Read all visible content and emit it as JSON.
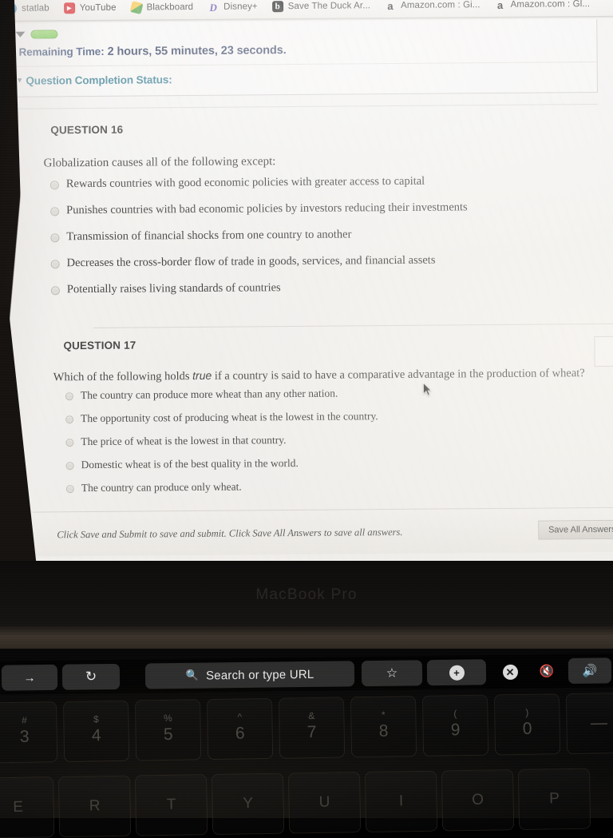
{
  "browser": {
    "bookmarks": [
      {
        "label": "statlab",
        "icon": "statlab-icon"
      },
      {
        "label": "YouTube",
        "icon": "youtube-icon"
      },
      {
        "label": "Blackboard",
        "icon": "blackboard-icon"
      },
      {
        "label": "Disney+",
        "icon": "disney-plus-icon"
      },
      {
        "label": "Save The Duck Ar...",
        "icon": "save-the-duck-icon"
      },
      {
        "label": "Amazon.com : Gi...",
        "icon": "amazon-icon"
      },
      {
        "label": "Amazon.com : Gl...",
        "icon": "amazon-icon"
      }
    ]
  },
  "exam": {
    "remaining_time_label": "Remaining Time:",
    "remaining_time_value": "2 hours, 55 minutes, 23 seconds.",
    "question_completion_status": "Question Completion Status:",
    "status_pill_color": "#76cc45",
    "questions": [
      {
        "heading": "QUESTION 16",
        "stem": "Globalization causes all of the following except:",
        "stem_italic_word": "",
        "options": [
          "Rewards countries with good economic policies with greater access to capital",
          "Punishes countries with bad economic policies by investors reducing their investments",
          "Transmission of financial shocks from one country to another",
          "Decreases the cross-border flow of trade in goods, services, and financial assets",
          "Potentially raises living standards of countries"
        ]
      },
      {
        "heading": "QUESTION 17",
        "stem_before": "Which of the following holds ",
        "stem_italic_word": "true",
        "stem_after": " if a country is said to have a comparative advantage in the production of wheat?",
        "options": [
          "The country can produce more wheat than any other nation.",
          "The opportunity cost of producing wheat is the lowest in the country.",
          "The price of wheat is the lowest in that country.",
          "Domestic wheat is of the best quality in the world.",
          "The country can produce only wheat."
        ]
      }
    ],
    "footer_note": "Click Save and Submit to save and submit. Click Save All Answers to save all answers.",
    "save_all_answers_label": "Save All Answers"
  },
  "laptop": {
    "brand_label": "MacBook Pro",
    "touchbar": {
      "forward_icon": "arrow-right-icon",
      "reload_icon": "reload-icon",
      "url_placeholder": "Search or type URL",
      "search_icon": "search-icon",
      "star_icon": "star-icon",
      "plus_icon": "plus-icon",
      "close_icon": "close-circle-icon",
      "mic_icon": "microphone-muted-icon",
      "volume_icon": "speaker-icon"
    },
    "keyboard": {
      "number_row": [
        {
          "upper": "#",
          "lower": "3"
        },
        {
          "upper": "$",
          "lower": "4"
        },
        {
          "upper": "%",
          "lower": "5"
        },
        {
          "upper": "^",
          "lower": "6"
        },
        {
          "upper": "&",
          "lower": "7"
        },
        {
          "upper": "*",
          "lower": "8"
        },
        {
          "upper": "(",
          "lower": "9"
        },
        {
          "upper": ")",
          "lower": "0"
        },
        {
          "upper": "",
          "lower": "—"
        }
      ],
      "letter_row": [
        {
          "lower": "E"
        },
        {
          "lower": "R"
        },
        {
          "lower": "T"
        },
        {
          "lower": "Y"
        },
        {
          "lower": "U"
        },
        {
          "lower": "I"
        },
        {
          "lower": "O"
        },
        {
          "lower": "P"
        }
      ]
    }
  }
}
